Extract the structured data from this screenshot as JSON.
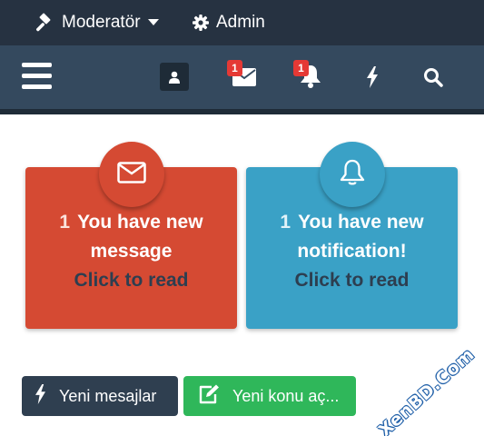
{
  "topbar": {
    "moderator_label": "Moderatör",
    "admin_label": "Admin",
    "background": "#263241"
  },
  "navbar": {
    "background": "#34495e",
    "icons": [
      "menu-icon",
      "user-icon",
      "envelope-icon",
      "bell-icon",
      "bolt-icon",
      "search-icon"
    ],
    "message_badge": "1",
    "alert_badge": "1"
  },
  "cards": {
    "message": {
      "count": "1",
      "text_line1": "You have new",
      "text_line2": "message",
      "link": "Click to read",
      "color": "#d54a33"
    },
    "notification": {
      "count": "1",
      "text_line1": "You have new",
      "text_line2": "notification!",
      "link": "Click to read",
      "color": "#3aa1c6"
    }
  },
  "buttons": {
    "new_messages": "Yeni mesajlar",
    "new_thread": "Yeni konu aç..."
  },
  "watermark": "XenBD.Com"
}
